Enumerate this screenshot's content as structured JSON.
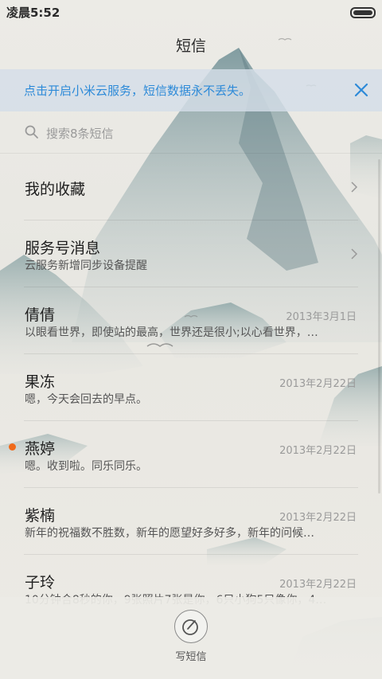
{
  "status_bar": {
    "time": "凌晨5:52"
  },
  "title": "短信",
  "banner": {
    "text": "点击开启小米云服务，短信数据永不丢失。"
  },
  "search": {
    "placeholder": "搜索8条短信"
  },
  "rows": [
    {
      "name": "我的收藏",
      "sub": "",
      "date": "",
      "chevron": true,
      "unread": false
    },
    {
      "name": "服务号消息",
      "sub": "云服务新增同步设备提醒",
      "date": "",
      "chevron": true,
      "unread": false
    },
    {
      "name": "倩倩",
      "sub": "以眼看世界，即使站的最高，世界还是很小;以心看世界，…",
      "date": "2013年3月1日",
      "chevron": false,
      "unread": false
    },
    {
      "name": "果冻",
      "sub": "嗯，今天会回去的早点。",
      "date": "2013年2月22日",
      "chevron": false,
      "unread": false
    },
    {
      "name": "燕婷",
      "sub": "嗯。收到啦。同乐同乐。",
      "date": "2013年2月22日",
      "chevron": false,
      "unread": true
    },
    {
      "name": "紫楠",
      "sub": "新年的祝福数不胜数，新年的愿望好多好多，新年的问候…",
      "date": "2013年2月22日",
      "chevron": false,
      "unread": false
    },
    {
      "name": "子玲",
      "sub": "10分钟合8秒的你，9张照片7张是你，6只小狗5只像你，4…",
      "date": "2013年2月22日",
      "chevron": false,
      "unread": false
    }
  ],
  "compose": {
    "label": "写短信"
  },
  "colors": {
    "accent": "#2d8ad8",
    "unread": "#f06a1a",
    "banner_bg": "#d4dee8"
  }
}
